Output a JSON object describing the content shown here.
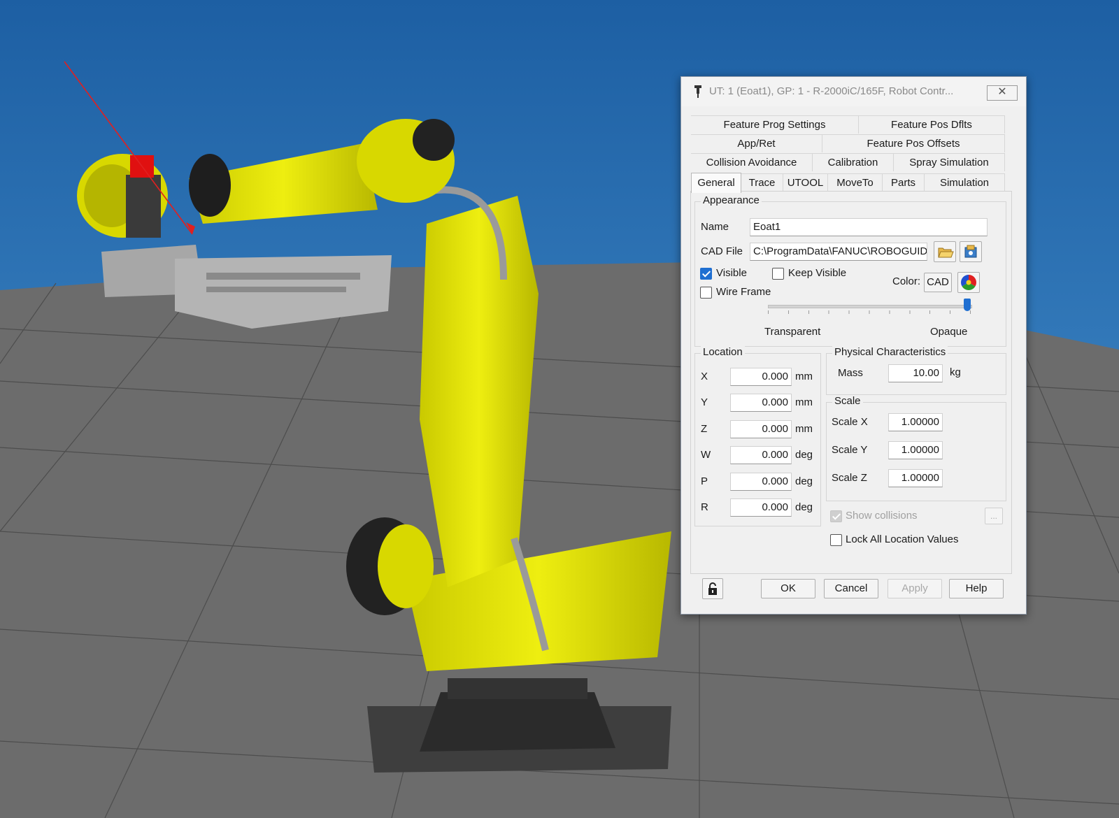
{
  "dialog": {
    "title": "UT: 1  (Eoat1), GP: 1 - R-2000iC/165F, Robot Contr...",
    "close_glyph": "✕",
    "tabs_row1": [
      "Feature Prog Settings",
      "Feature Pos Dflts"
    ],
    "tabs_row2": [
      "App/Ret",
      "Feature Pos Offsets"
    ],
    "tabs_row3": [
      "Collision Avoidance",
      "Calibration",
      "Spray Simulation"
    ],
    "tabs_row4": [
      "General",
      "Trace",
      "UTOOL",
      "MoveTo",
      "Parts",
      "Simulation"
    ],
    "active_tab": "General",
    "appearance": {
      "caption": "Appearance",
      "name_label": "Name",
      "name_value": "Eoat1",
      "cad_label": "CAD File",
      "cad_value": "C:\\ProgramData\\FANUC\\ROBOGUIDE\\",
      "visible_label": "Visible",
      "visible_checked": true,
      "keep_visible_label": "Keep Visible",
      "keep_visible_checked": false,
      "wireframe_label": "Wire Frame",
      "wireframe_checked": false,
      "color_label": "Color:",
      "cad_button": "CAD",
      "transparent_label": "Transparent",
      "opaque_label": "Opaque",
      "opacity_fraction": 1.0
    },
    "location": {
      "caption": "Location",
      "rows": [
        {
          "axis": "X",
          "value": "0.000",
          "unit": "mm"
        },
        {
          "axis": "Y",
          "value": "0.000",
          "unit": "mm"
        },
        {
          "axis": "Z",
          "value": "0.000",
          "unit": "mm"
        },
        {
          "axis": "W",
          "value": "0.000",
          "unit": "deg"
        },
        {
          "axis": "P",
          "value": "0.000",
          "unit": "deg"
        },
        {
          "axis": "R",
          "value": "0.000",
          "unit": "deg"
        }
      ]
    },
    "physical": {
      "caption": "Physical Characteristics",
      "mass_label": "Mass",
      "mass_value": "10.00",
      "mass_unit": "kg"
    },
    "scale": {
      "caption": "Scale",
      "rows": [
        {
          "label": "Scale X",
          "value": "1.00000"
        },
        {
          "label": "Scale Y",
          "value": "1.00000"
        },
        {
          "label": "Scale Z",
          "value": "1.00000"
        }
      ]
    },
    "show_collisions_label": "Show collisions",
    "ellipsis_label": "...",
    "lock_label": "Lock All Location Values",
    "lock_checked": false,
    "buttons": {
      "ok": "OK",
      "cancel": "Cancel",
      "apply": "Apply",
      "help": "Help"
    }
  },
  "colors": {
    "sky_top": "#1d5fa3",
    "sky_bottom": "#4e9ad6",
    "floor": "#6c6c6c",
    "robot_yellow": "#e6e600",
    "accent_blue": "#1f6fd1"
  }
}
